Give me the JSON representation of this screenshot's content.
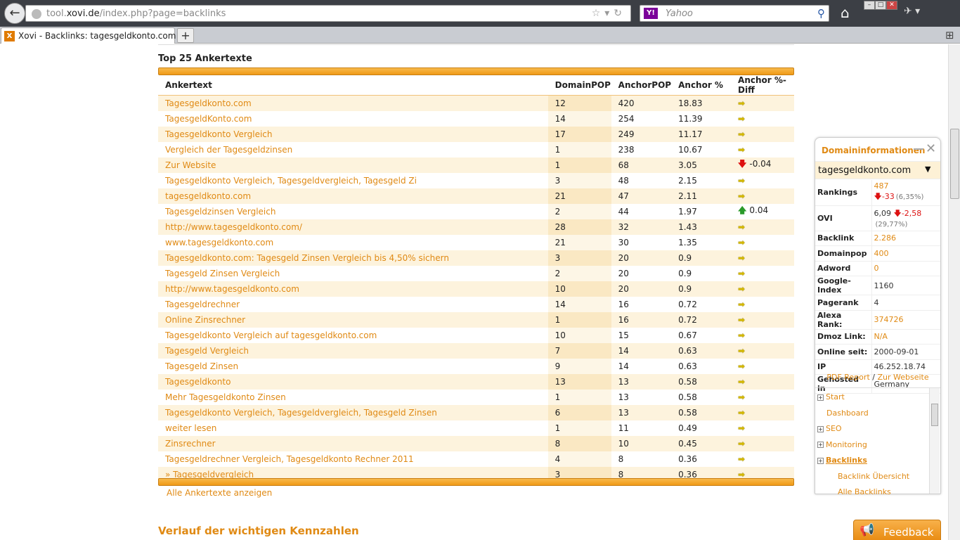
{
  "browser": {
    "url_prefix": "tool.",
    "url_domain": "xovi.de",
    "url_path": "/index.php?page=backlinks",
    "search_placeholder": "Yahoo",
    "search_logo": "Y!",
    "tab_title": "Xovi - Backlinks: tagesgeldkonto.com",
    "new_tab": "+"
  },
  "section": {
    "title": "Top 25 Ankertexte",
    "show_all": "Alle Ankertexte anzeigen",
    "next_title": "Verlauf der wichtigen Kennzahlen"
  },
  "table": {
    "headers": [
      "Ankertext",
      "DomainPOP",
      "AnchorPOP",
      "Anchor %",
      "Anchor %-Diff"
    ],
    "rows": [
      {
        "anchor": "Tagesgeldkonto.com",
        "dpop": "12",
        "apop": "420",
        "pct": "18.83",
        "trend": "flat",
        "diff": ""
      },
      {
        "anchor": "TagesgeldKonto.com",
        "dpop": "14",
        "apop": "254",
        "pct": "11.39",
        "trend": "flat",
        "diff": ""
      },
      {
        "anchor": "Tagesgeldkonto Vergleich",
        "dpop": "17",
        "apop": "249",
        "pct": "11.17",
        "trend": "flat",
        "diff": ""
      },
      {
        "anchor": "Vergleich der Tagesgeldzinsen",
        "dpop": "1",
        "apop": "238",
        "pct": "10.67",
        "trend": "flat",
        "diff": ""
      },
      {
        "anchor": "Zur Website",
        "dpop": "1",
        "apop": "68",
        "pct": "3.05",
        "trend": "down",
        "diff": "-0.04"
      },
      {
        "anchor": "Tagesgeldkonto Vergleich, Tagesgeldvergleich, Tagesgeld Zi",
        "dpop": "3",
        "apop": "48",
        "pct": "2.15",
        "trend": "flat",
        "diff": ""
      },
      {
        "anchor": "tagesgeldkonto.com",
        "dpop": "21",
        "apop": "47",
        "pct": "2.11",
        "trend": "flat",
        "diff": ""
      },
      {
        "anchor": "Tagesgeldzinsen Vergleich",
        "dpop": "2",
        "apop": "44",
        "pct": "1.97",
        "trend": "up",
        "diff": "0.04"
      },
      {
        "anchor": "http://www.tagesgeldkonto.com/",
        "dpop": "28",
        "apop": "32",
        "pct": "1.43",
        "trend": "flat",
        "diff": ""
      },
      {
        "anchor": "www.tagesgeldkonto.com",
        "dpop": "21",
        "apop": "30",
        "pct": "1.35",
        "trend": "flat",
        "diff": ""
      },
      {
        "anchor": "Tagesgeldkonto.com: Tagesgeld Zinsen Vergleich bis 4,50% sichern",
        "dpop": "3",
        "apop": "20",
        "pct": "0.9",
        "trend": "flat",
        "diff": ""
      },
      {
        "anchor": "Tagesgeld Zinsen Vergleich",
        "dpop": "2",
        "apop": "20",
        "pct": "0.9",
        "trend": "flat",
        "diff": ""
      },
      {
        "anchor": "http://www.tagesgeldkonto.com",
        "dpop": "10",
        "apop": "20",
        "pct": "0.9",
        "trend": "flat",
        "diff": ""
      },
      {
        "anchor": "Tagesgeldrechner",
        "dpop": "14",
        "apop": "16",
        "pct": "0.72",
        "trend": "flat",
        "diff": ""
      },
      {
        "anchor": "Online Zinsrechner",
        "dpop": "1",
        "apop": "16",
        "pct": "0.72",
        "trend": "flat",
        "diff": ""
      },
      {
        "anchor": "Tagesgeldkonto Vergleich auf tagesgeldkonto.com",
        "dpop": "10",
        "apop": "15",
        "pct": "0.67",
        "trend": "flat",
        "diff": ""
      },
      {
        "anchor": "Tagesgeld Vergleich",
        "dpop": "7",
        "apop": "14",
        "pct": "0.63",
        "trend": "flat",
        "diff": ""
      },
      {
        "anchor": "Tagesgeld Zinsen",
        "dpop": "9",
        "apop": "14",
        "pct": "0.63",
        "trend": "flat",
        "diff": ""
      },
      {
        "anchor": "Tagesgeldkonto",
        "dpop": "13",
        "apop": "13",
        "pct": "0.58",
        "trend": "flat",
        "diff": ""
      },
      {
        "anchor": "Mehr Tagesgeldkonto Zinsen",
        "dpop": "1",
        "apop": "13",
        "pct": "0.58",
        "trend": "flat",
        "diff": ""
      },
      {
        "anchor": "Tagesgeldkonto Vergleich, Tagesgeldvergleich, Tagesgeld Zinsen",
        "dpop": "6",
        "apop": "13",
        "pct": "0.58",
        "trend": "flat",
        "diff": ""
      },
      {
        "anchor": "weiter lesen",
        "dpop": "1",
        "apop": "11",
        "pct": "0.49",
        "trend": "flat",
        "diff": ""
      },
      {
        "anchor": "Zinsrechner",
        "dpop": "8",
        "apop": "10",
        "pct": "0.45",
        "trend": "flat",
        "diff": ""
      },
      {
        "anchor": "Tagesgeldrechner Vergleich, Tagesgeldkonto Rechner 2011",
        "dpop": "4",
        "apop": "8",
        "pct": "0.36",
        "trend": "flat",
        "diff": ""
      },
      {
        "anchor": "» Tagesgeldvergleich",
        "dpop": "3",
        "apop": "8",
        "pct": "0.36",
        "trend": "flat",
        "diff": ""
      }
    ]
  },
  "widget": {
    "title": "Domaininformationen",
    "domain": "tagesgeldkonto.com",
    "rows": [
      {
        "key": "Rankings",
        "value": "487",
        "link": true,
        "delta": "-33",
        "extra": "(6,35%)"
      },
      {
        "key": "OVI",
        "value": "6,09",
        "link": false,
        "delta": "-2,58",
        "extra": "(29,77%)"
      },
      {
        "key": "Backlink",
        "value": "2.286",
        "link": true,
        "delta": "",
        "extra": ""
      },
      {
        "key": "Domainpop",
        "value": "400",
        "link": true,
        "delta": "",
        "extra": ""
      },
      {
        "key": "Adword",
        "value": "0",
        "link": true,
        "delta": "",
        "extra": ""
      },
      {
        "key": "Google-Index",
        "value": "1160",
        "link": false,
        "delta": "",
        "extra": ""
      },
      {
        "key": "Pagerank",
        "value": "4",
        "link": false,
        "delta": "",
        "extra": ""
      },
      {
        "key": "Alexa Rank:",
        "value": "374726",
        "link": true,
        "delta": "",
        "extra": ""
      },
      {
        "key": "Dmoz Link:",
        "value": "N/A",
        "link": true,
        "delta": "",
        "extra": ""
      },
      {
        "key": "Online seit:",
        "value": "2000-09-01",
        "link": false,
        "delta": "",
        "extra": ""
      },
      {
        "key": "IP",
        "value": "46.252.18.74",
        "link": false,
        "delta": "",
        "extra": ""
      },
      {
        "key": "Gehosted in",
        "value": "Germany",
        "link": false,
        "delta": "",
        "extra": ""
      }
    ],
    "pdf_report": "PDF Report",
    "separator": "/",
    "website": "Zur Webseite",
    "tree": [
      {
        "label": "Start",
        "expandable": true,
        "level": 0
      },
      {
        "label": "Dashboard",
        "expandable": false,
        "level": 0
      },
      {
        "label": "SEO",
        "expandable": true,
        "level": 0
      },
      {
        "label": "Monitoring",
        "expandable": true,
        "level": 0
      },
      {
        "label": "Backlinks",
        "expandable": true,
        "level": 0,
        "active": true
      },
      {
        "label": "Backlink Übersicht",
        "expandable": false,
        "level": 1
      },
      {
        "label": "Alle Backlinks",
        "expandable": false,
        "level": 1
      }
    ]
  },
  "feedback": {
    "label": "Feedback"
  },
  "colors": {
    "accent": "#e08a14",
    "bar": "#f09a17",
    "row_alt": "#fdf3dd",
    "down": "#dd1111",
    "up": "#2a9a2a"
  }
}
